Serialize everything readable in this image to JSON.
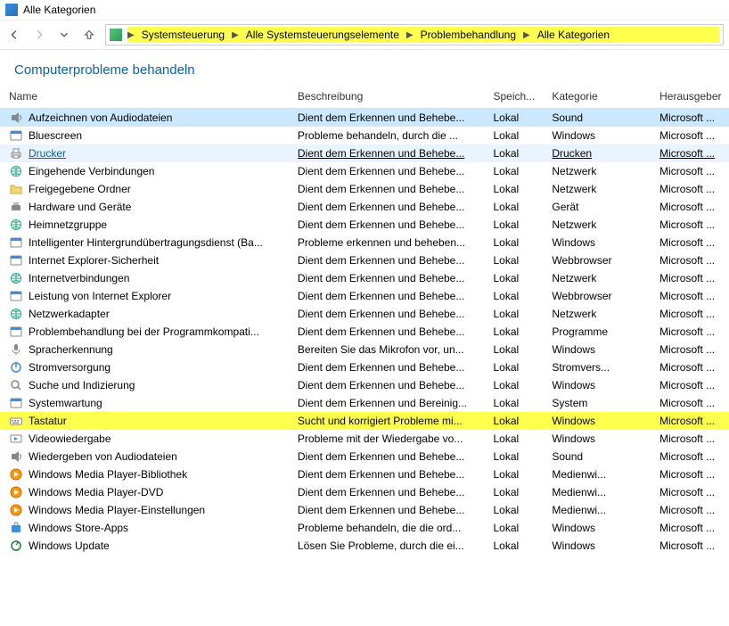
{
  "window_title": "Alle Kategorien",
  "breadcrumbs": [
    "Systemsteuerung",
    "Alle Systemsteuerungselemente",
    "Problembehandlung",
    "Alle Kategorien"
  ],
  "heading": "Computerprobleme behandeln",
  "columns": {
    "name": "Name",
    "desc": "Beschreibung",
    "loc": "Speich...",
    "cat": "Kategorie",
    "pub": "Herausgeber"
  },
  "rows": [
    {
      "icon": "audio-rec",
      "name": "Aufzeichnen von Audiodateien",
      "desc": "Dient dem Erkennen und Behebe...",
      "loc": "Lokal",
      "cat": "Sound",
      "pub": "Microsoft ...",
      "state": "selected"
    },
    {
      "icon": "bluescreen",
      "name": "Bluescreen",
      "desc": "Probleme behandeln, durch die ...",
      "loc": "Lokal",
      "cat": "Windows",
      "pub": "Microsoft ..."
    },
    {
      "icon": "printer",
      "name": "Drucker",
      "desc": "Dient dem Erkennen und Behebe...",
      "loc": "Lokal",
      "cat": "Drucken",
      "pub": "Microsoft ...",
      "state": "hover",
      "underline": true
    },
    {
      "icon": "net-in",
      "name": "Eingehende Verbindungen",
      "desc": "Dient dem Erkennen und Behebe...",
      "loc": "Lokal",
      "cat": "Netzwerk",
      "pub": "Microsoft ..."
    },
    {
      "icon": "shared",
      "name": "Freigegebene Ordner",
      "desc": "Dient dem Erkennen und Behebe...",
      "loc": "Lokal",
      "cat": "Netzwerk",
      "pub": "Microsoft ..."
    },
    {
      "icon": "hardware",
      "name": "Hardware und Geräte",
      "desc": "Dient dem Erkennen und Behebe...",
      "loc": "Lokal",
      "cat": "Gerät",
      "pub": "Microsoft ..."
    },
    {
      "icon": "homegroup",
      "name": "Heimnetzgruppe",
      "desc": "Dient dem Erkennen und Behebe...",
      "loc": "Lokal",
      "cat": "Netzwerk",
      "pub": "Microsoft ..."
    },
    {
      "icon": "bits",
      "name": "Intelligenter Hintergrundübertragungsdienst (Ba...",
      "desc": "Probleme erkennen und beheben...",
      "loc": "Lokal",
      "cat": "Windows",
      "pub": "Microsoft ..."
    },
    {
      "icon": "ie-shield",
      "name": "Internet Explorer-Sicherheit",
      "desc": "Dient dem Erkennen und Behebe...",
      "loc": "Lokal",
      "cat": "Webbrowser",
      "pub": "Microsoft ..."
    },
    {
      "icon": "net",
      "name": "Internetverbindungen",
      "desc": "Dient dem Erkennen und Behebe...",
      "loc": "Lokal",
      "cat": "Netzwerk",
      "pub": "Microsoft ..."
    },
    {
      "icon": "ie-perf",
      "name": "Leistung von Internet Explorer",
      "desc": "Dient dem Erkennen und Behebe...",
      "loc": "Lokal",
      "cat": "Webbrowser",
      "pub": "Microsoft ..."
    },
    {
      "icon": "nic",
      "name": "Netzwerkadapter",
      "desc": "Dient dem Erkennen und Behebe...",
      "loc": "Lokal",
      "cat": "Netzwerk",
      "pub": "Microsoft ..."
    },
    {
      "icon": "compat",
      "name": "Problembehandlung bei der Programmkompati...",
      "desc": "Dient dem Erkennen und Behebe...",
      "loc": "Lokal",
      "cat": "Programme",
      "pub": "Microsoft ..."
    },
    {
      "icon": "mic",
      "name": "Spracherkennung",
      "desc": "Bereiten Sie das Mikrofon vor, un...",
      "loc": "Lokal",
      "cat": "Windows",
      "pub": "Microsoft ..."
    },
    {
      "icon": "power",
      "name": "Stromversorgung",
      "desc": "Dient dem Erkennen und Behebe...",
      "loc": "Lokal",
      "cat": "Stromvers...",
      "pub": "Microsoft ..."
    },
    {
      "icon": "search",
      "name": "Suche und Indizierung",
      "desc": "Dient dem Erkennen und Behebe...",
      "loc": "Lokal",
      "cat": "Windows",
      "pub": "Microsoft ..."
    },
    {
      "icon": "maint",
      "name": "Systemwartung",
      "desc": "Dient dem Erkennen und Bereinig...",
      "loc": "Lokal",
      "cat": "System",
      "pub": "Microsoft ..."
    },
    {
      "icon": "keyboard",
      "name": "Tastatur",
      "desc": "Sucht und korrigiert Probleme mi...",
      "loc": "Lokal",
      "cat": "Windows",
      "pub": "Microsoft ...",
      "state": "hl"
    },
    {
      "icon": "video",
      "name": "Videowiedergabe",
      "desc": "Probleme mit der Wiedergabe vo...",
      "loc": "Lokal",
      "cat": "Windows",
      "pub": "Microsoft ..."
    },
    {
      "icon": "audio-play",
      "name": "Wiedergeben von Audiodateien",
      "desc": "Dient dem Erkennen und Behebe...",
      "loc": "Lokal",
      "cat": "Sound",
      "pub": "Microsoft ..."
    },
    {
      "icon": "wmp",
      "name": "Windows Media Player-Bibliothek",
      "desc": "Dient dem Erkennen und Behebe...",
      "loc": "Lokal",
      "cat": "Medienwi...",
      "pub": "Microsoft ..."
    },
    {
      "icon": "wmp",
      "name": "Windows Media Player-DVD",
      "desc": "Dient dem Erkennen und Behebe...",
      "loc": "Lokal",
      "cat": "Medienwi...",
      "pub": "Microsoft ..."
    },
    {
      "icon": "wmp",
      "name": "Windows Media Player-Einstellungen",
      "desc": "Dient dem Erkennen und Behebe...",
      "loc": "Lokal",
      "cat": "Medienwi...",
      "pub": "Microsoft ..."
    },
    {
      "icon": "store",
      "name": "Windows Store-Apps",
      "desc": "Probleme behandeln, die die ord...",
      "loc": "Lokal",
      "cat": "Windows",
      "pub": "Microsoft ..."
    },
    {
      "icon": "update",
      "name": "Windows Update",
      "desc": "Lösen Sie Probleme, durch die ei...",
      "loc": "Lokal",
      "cat": "Windows",
      "pub": "Microsoft ..."
    }
  ]
}
